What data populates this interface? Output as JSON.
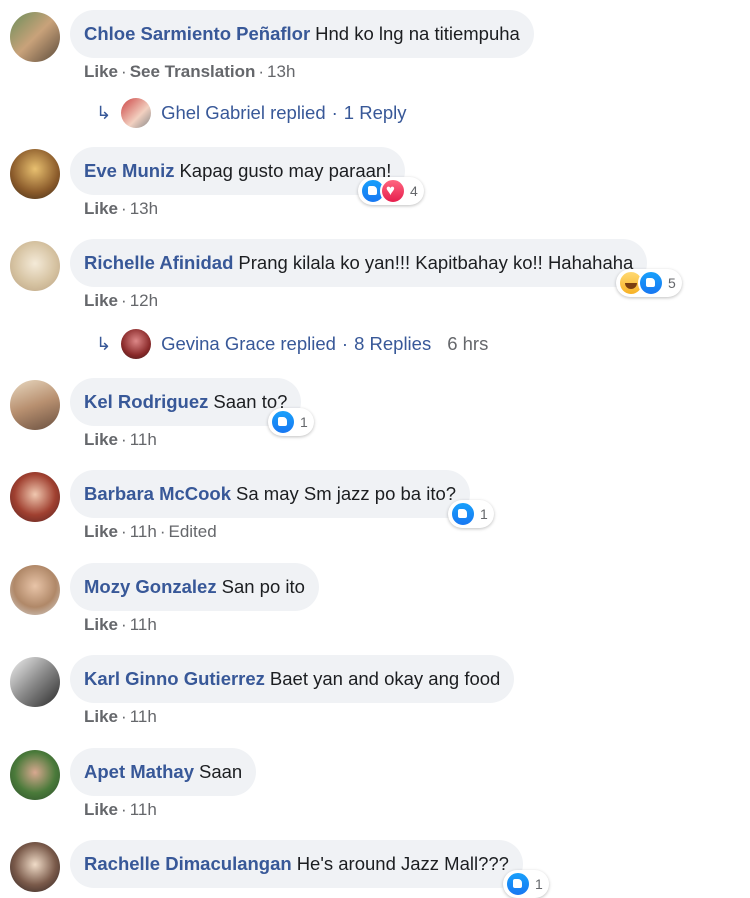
{
  "comments": [
    {
      "author": "Chloe Sarmiento Peñaflor",
      "text": "Hnd ko lng na titiempuha",
      "like": "Like",
      "sep1": "·",
      "translate": "See Translation",
      "sep2": "·",
      "time": "13h"
    },
    {
      "author": "Eve Muniz",
      "text": "Kapag gusto may paraan!",
      "like": "Like",
      "sep": "·",
      "time": "13h",
      "reaction_count": "4"
    },
    {
      "author": "Richelle Afinidad",
      "text": "Prang kilala ko yan!!! Kapitbahay ko!! Hahahaha",
      "like": "Like",
      "sep": "·",
      "time": "12h",
      "reaction_count": "5"
    },
    {
      "author": "Kel Rodriguez",
      "text": "Saan to?",
      "like": "Like",
      "sep": "·",
      "time": "11h",
      "reaction_count": "1"
    },
    {
      "author": "Barbara McCook",
      "text": "Sa may Sm jazz po ba ito?",
      "like": "Like",
      "sep1": "·",
      "time": "11h",
      "sep2": "·",
      "edited": "Edited",
      "reaction_count": "1"
    },
    {
      "author": "Mozy Gonzalez",
      "text": "San po ito",
      "like": "Like",
      "sep": "·",
      "time": "11h"
    },
    {
      "author": "Karl Ginno Gutierrez",
      "text": "Baet yan and okay ang food",
      "like": "Like",
      "sep": "·",
      "time": "11h"
    },
    {
      "author": "Apet Mathay",
      "text": "Saan",
      "like": "Like",
      "sep": "·",
      "time": "11h"
    },
    {
      "author": "Rachelle Dimaculangan",
      "text": "He's around Jazz Mall???",
      "reaction_count": "1"
    }
  ],
  "replies": [
    {
      "name": "Ghel Gabriel replied",
      "sep": "·",
      "count": "1 Reply"
    },
    {
      "name": "Gevina Grace replied",
      "sep": "·",
      "count": "8 Replies",
      "time": "6 hrs"
    }
  ],
  "colors": {
    "link": "#385898",
    "muted": "#65676b",
    "bubble": "#f0f2f5",
    "like_blue": "#1877f2",
    "love_red": "#e61e4d",
    "haha_yellow": "#f7b125"
  }
}
